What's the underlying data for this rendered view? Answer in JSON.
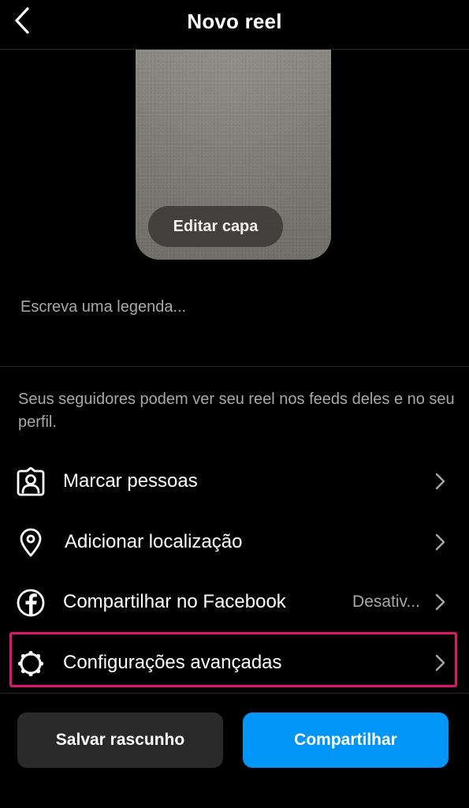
{
  "header": {
    "title": "Novo reel",
    "back_icon": "chevron-left-icon"
  },
  "cover": {
    "edit_label": "Editar capa"
  },
  "caption": {
    "placeholder": "Escreva uma legenda...",
    "value": ""
  },
  "info": {
    "text": "Seus seguidores podem ver seu reel nos feeds deles e no seu perfil."
  },
  "options": [
    {
      "label": "Marcar pessoas",
      "icon": "tag-person-icon",
      "value": ""
    },
    {
      "label": "Adicionar localização",
      "icon": "location-pin-icon",
      "value": ""
    },
    {
      "label": "Compartilhar no Facebook",
      "icon": "facebook-icon",
      "value": "Desativ..."
    },
    {
      "label": "Configurações avançadas",
      "icon": "gear-icon",
      "value": ""
    }
  ],
  "actions": {
    "save_draft_label": "Salvar rascunho",
    "share_label": "Compartilhar"
  },
  "colors": {
    "background": "#000000",
    "share_button": "#0095f6",
    "draft_button": "#2a2a2a",
    "highlight": "#e0156c",
    "secondary_text": "#a8a8a8"
  }
}
